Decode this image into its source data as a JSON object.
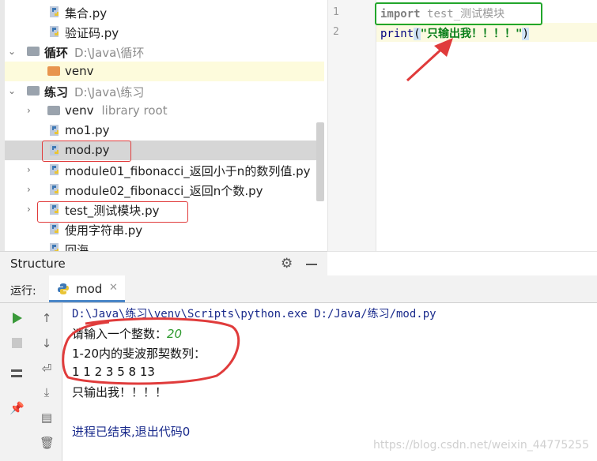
{
  "project_tree": {
    "items": [
      {
        "label": "集合.py"
      },
      {
        "label": "验证码.py"
      },
      {
        "label": "循环",
        "path": "D:\\Java\\循环"
      },
      {
        "label": "venv"
      },
      {
        "label": "练习",
        "path": "D:\\Java\\练习"
      },
      {
        "label": "venv",
        "sub": "library root"
      },
      {
        "label": "mo1.py"
      },
      {
        "label": "mod.py"
      },
      {
        "label": "module01_fibonacci_返回小于n的数列值.py"
      },
      {
        "label": "module02_fibonacci_返回n个数.py"
      },
      {
        "label": "test_测试模块.py"
      },
      {
        "label": "使用字符串.py"
      },
      {
        "label": "回海"
      }
    ]
  },
  "editor": {
    "lines": [
      {
        "num": "1",
        "kw": "import",
        "module": "test_测试模块"
      },
      {
        "num": "2",
        "fn": "print",
        "open": "(",
        "str": "\"只输出我！！！！\"",
        "close": ")"
      }
    ]
  },
  "structure": {
    "title": "Structure"
  },
  "run": {
    "label": "运行:",
    "tab_name": "mod"
  },
  "console": {
    "cmd": "D:\\Java\\练习\\venv\\Scripts\\python.exe D:/Java/练习/mod.py",
    "prompt": "请输入一个整数：",
    "input": "20",
    "fib_title": "1-20内的斐波那契数列：",
    "fib_values": "1 1 2 3 5 8 13",
    "only_me": "只输出我！！！！",
    "exit": "进程已结束,退出代码0"
  },
  "watermark": "https://blog.csdn.net/weixin_44775255",
  "colors": {
    "red_annotation": "#e03b3b",
    "green_box": "#22a62b",
    "accent_tab": "#4a86c7"
  }
}
